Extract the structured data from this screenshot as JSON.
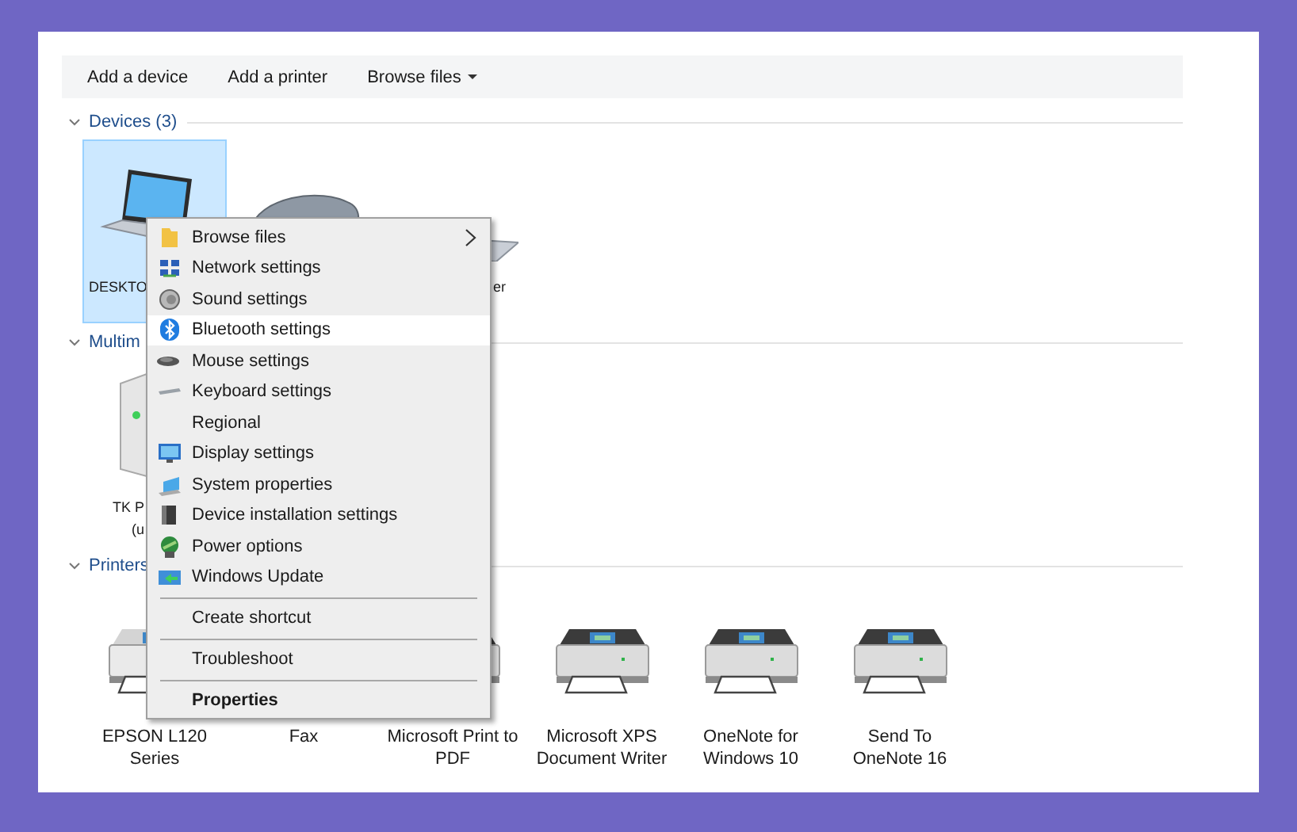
{
  "toolbar": {
    "buttons": [
      {
        "label": "Add a device",
        "dropdown": false
      },
      {
        "label": "Add a printer",
        "dropdown": false
      },
      {
        "label": "Browse files",
        "dropdown": true
      }
    ]
  },
  "sections": [
    {
      "title": "Devices (3)",
      "expanded": true,
      "items": [
        {
          "lines": [
            "DESKTO"
          ],
          "selected": true
        },
        {
          "selected": false
        },
        {
          "lines": [
            "er"
          ],
          "selected": false
        }
      ]
    },
    {
      "title": "Multim",
      "expanded": true,
      "items": [
        {
          "lines": [
            "TK P",
            "(u"
          ],
          "selected": false
        }
      ]
    },
    {
      "title": "Printers",
      "expanded": true,
      "items": [
        {
          "lines": [
            "EPSON L120",
            "Series"
          ],
          "selected": false
        },
        {
          "lines": [
            "Fax"
          ],
          "selected": false
        },
        {
          "lines": [
            "Microsoft Print to",
            "PDF"
          ],
          "selected": false
        },
        {
          "lines": [
            "Microsoft XPS",
            "Document Writer"
          ],
          "selected": false
        },
        {
          "lines": [
            "OneNote for",
            "Windows 10"
          ],
          "selected": false
        },
        {
          "lines": [
            "Send To",
            "OneNote 16"
          ],
          "selected": false
        }
      ]
    }
  ],
  "context_menu": {
    "groups": [
      [
        {
          "label": "Browse files",
          "submenu": true,
          "selected": false,
          "default": false
        },
        {
          "label": "Network settings",
          "submenu": false,
          "selected": false,
          "default": false
        },
        {
          "label": "Sound settings",
          "submenu": false,
          "selected": false,
          "default": false
        },
        {
          "label": "Bluetooth settings",
          "submenu": false,
          "selected": true,
          "default": false
        },
        {
          "label": "Mouse settings",
          "submenu": false,
          "selected": false,
          "default": false
        },
        {
          "label": "Keyboard settings",
          "submenu": false,
          "selected": false,
          "default": false
        },
        {
          "label": "Regional",
          "submenu": false,
          "selected": false,
          "default": false
        },
        {
          "label": "Display settings",
          "submenu": false,
          "selected": false,
          "default": false
        },
        {
          "label": "System properties",
          "submenu": false,
          "selected": false,
          "default": false
        },
        {
          "label": "Device installation settings",
          "submenu": false,
          "selected": false,
          "default": false
        },
        {
          "label": "Power options",
          "submenu": false,
          "selected": false,
          "default": false
        },
        {
          "label": "Windows Update",
          "submenu": false,
          "selected": false,
          "default": false
        }
      ],
      [
        {
          "label": "Create shortcut",
          "submenu": false,
          "selected": false,
          "default": false
        }
      ],
      [
        {
          "label": "Troubleshoot",
          "submenu": false,
          "selected": false,
          "default": false
        }
      ],
      [
        {
          "label": "Properties",
          "submenu": false,
          "selected": false,
          "default": true
        }
      ]
    ]
  }
}
